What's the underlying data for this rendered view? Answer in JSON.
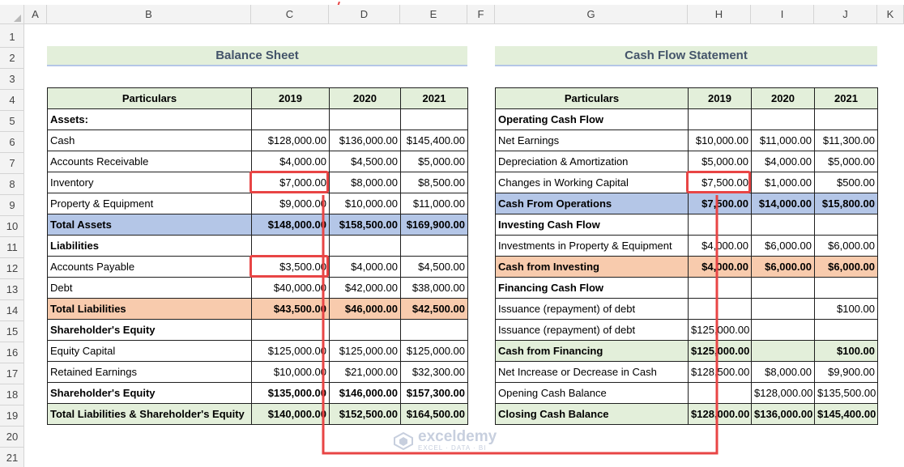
{
  "columns": [
    "A",
    "B",
    "C",
    "D",
    "E",
    "F",
    "G",
    "H",
    "I",
    "J",
    "K"
  ],
  "rows": [
    "1",
    "2",
    "3",
    "4",
    "5",
    "6",
    "7",
    "8",
    "9",
    "10",
    "11",
    "12",
    "13",
    "14",
    "15",
    "16",
    "17",
    "18",
    "19",
    "20",
    "21"
  ],
  "balance_sheet": {
    "title": "Balance Sheet",
    "headers": [
      "Particulars",
      "2019",
      "2020",
      "2021"
    ],
    "rows": [
      {
        "label": "Assets:",
        "v": [
          "",
          "",
          ""
        ],
        "style": "bold"
      },
      {
        "label": "Cash",
        "v": [
          "$128,000.00",
          "$136,000.00",
          "$145,400.00"
        ],
        "style": ""
      },
      {
        "label": "Accounts Receivable",
        "v": [
          "$4,000.00",
          "$4,500.00",
          "$5,000.00"
        ],
        "style": ""
      },
      {
        "label": "Inventory",
        "v": [
          "$7,000.00",
          "$8,000.00",
          "$8,500.00"
        ],
        "style": ""
      },
      {
        "label": "Property & Equipment",
        "v": [
          "$9,000.00",
          "$10,000.00",
          "$11,000.00"
        ],
        "style": ""
      },
      {
        "label": "Total Assets",
        "v": [
          "$148,000.00",
          "$158,500.00",
          "$169,900.00"
        ],
        "style": "bold blue"
      },
      {
        "label": "Liabilities",
        "v": [
          "",
          "",
          ""
        ],
        "style": "bold"
      },
      {
        "label": "Accounts Payable",
        "v": [
          "$3,500.00",
          "$4,000.00",
          "$4,500.00"
        ],
        "style": ""
      },
      {
        "label": "Debt",
        "v": [
          "$40,000.00",
          "$42,000.00",
          "$38,000.00"
        ],
        "style": ""
      },
      {
        "label": "Total Liabilities",
        "v": [
          "$43,500.00",
          "$46,000.00",
          "$42,500.00"
        ],
        "style": "bold orange"
      },
      {
        "label": "Shareholder's Equity",
        "v": [
          "",
          "",
          ""
        ],
        "style": "bold"
      },
      {
        "label": "Equity Capital",
        "v": [
          "$125,000.00",
          "$125,000.00",
          "$125,000.00"
        ],
        "style": ""
      },
      {
        "label": "Retained Earnings",
        "v": [
          "$10,000.00",
          "$21,000.00",
          "$32,300.00"
        ],
        "style": ""
      },
      {
        "label": "Shareholder's Equity",
        "v": [
          "$135,000.00",
          "$146,000.00",
          "$157,300.00"
        ],
        "style": "bold"
      },
      {
        "label": "Total Liabilities & Shareholder's Equity",
        "v": [
          "$140,000.00",
          "$152,500.00",
          "$164,500.00"
        ],
        "style": "bold green"
      }
    ]
  },
  "cash_flow": {
    "title": "Cash Flow Statement",
    "headers": [
      "Particulars",
      "2019",
      "2020",
      "2021"
    ],
    "rows": [
      {
        "label": "Operating Cash Flow",
        "v": [
          "",
          "",
          ""
        ],
        "style": "bold"
      },
      {
        "label": "Net Earnings",
        "v": [
          "$10,000.00",
          "$11,000.00",
          "$11,300.00"
        ],
        "style": ""
      },
      {
        "label": "Depreciation & Amortization",
        "v": [
          "$5,000.00",
          "$4,000.00",
          "$5,000.00"
        ],
        "style": ""
      },
      {
        "label": "Changes in Working Capital",
        "v": [
          "$7,500.00",
          "$1,000.00",
          "$500.00"
        ],
        "style": ""
      },
      {
        "label": "Cash From Operations",
        "v": [
          "$7,500.00",
          "$14,000.00",
          "$15,800.00"
        ],
        "style": "bold blue"
      },
      {
        "label": "Investing Cash Flow",
        "v": [
          "",
          "",
          ""
        ],
        "style": "bold"
      },
      {
        "label": "Investments in Property & Equipment",
        "v": [
          "$4,000.00",
          "$6,000.00",
          "$6,000.00"
        ],
        "style": ""
      },
      {
        "label": "Cash from Investing",
        "v": [
          "$4,000.00",
          "$6,000.00",
          "$6,000.00"
        ],
        "style": "bold orange"
      },
      {
        "label": "Financing Cash Flow",
        "v": [
          "",
          "",
          ""
        ],
        "style": "bold"
      },
      {
        "label": "Issuance (repayment) of debt",
        "v": [
          "",
          "",
          "$100.00"
        ],
        "style": ""
      },
      {
        "label": "Issuance (repayment) of debt",
        "v": [
          "$125,000.00",
          "",
          ""
        ],
        "style": ""
      },
      {
        "label": "Cash from Financing",
        "v": [
          "$125,000.00",
          "",
          "$100.00"
        ],
        "style": "bold green"
      },
      {
        "label": "Net Increase or Decrease in Cash",
        "v": [
          "$128,500.00",
          "$8,000.00",
          "$9,900.00"
        ],
        "style": ""
      },
      {
        "label": "Opening Cash Balance",
        "v": [
          "",
          "$128,000.00",
          "$135,500.00"
        ],
        "style": ""
      },
      {
        "label": "Closing Cash Balance",
        "v": [
          "$128,000.00",
          "$136,000.00",
          "$145,400.00"
        ],
        "style": "bold green"
      }
    ]
  },
  "watermark": {
    "name": "exceldemy",
    "tagline": "EXCEL · DATA · BI"
  },
  "colors": {
    "highlight": "#e84545",
    "header_fill": "#e3efda",
    "blue_fill": "#b4c6e7",
    "orange_fill": "#f8cbad"
  }
}
